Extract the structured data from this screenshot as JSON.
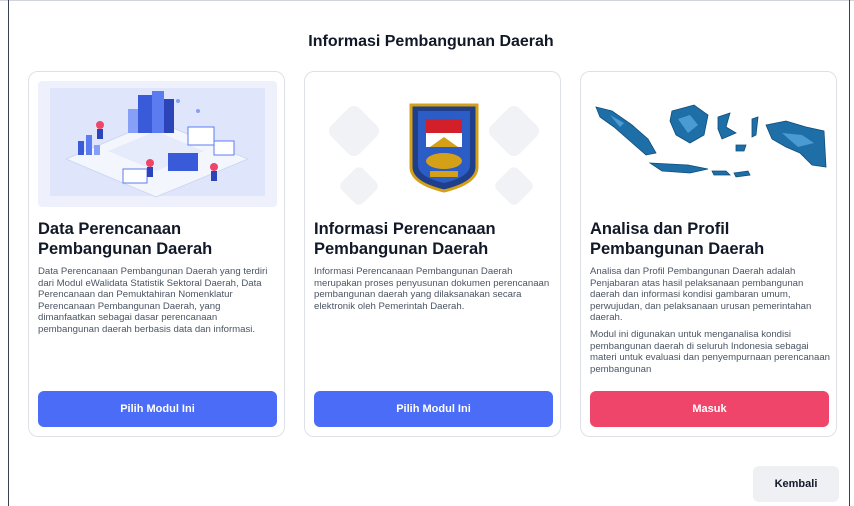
{
  "page": {
    "title": "Informasi Pembangunan Daerah"
  },
  "cards": [
    {
      "title": "Data Perencanaan Pembangunan Daerah",
      "description": [
        "Data Perencanaan Pembangunan Daerah yang terdiri dari Modul eWalidata Statistik Sektoral Daerah, Data Perencanaan dan Pemuktahiran Nomenklatur Perencanaan Pembangunan Daerah, yang dimanfaatkan sebagai dasar perencanaan pembangunan daerah berbasis data dan informasi."
      ],
      "button_label": "Pilih Modul Ini",
      "button_color": "#4a6cf7",
      "image_icon": "isometric-data-illustration"
    },
    {
      "title": "Informasi Perencanaan Pembangunan Daerah",
      "description": [
        "Informasi Perencanaan Pembangunan Daerah merupakan proses penyusunan dokumen perencanaan pembangunan daerah yang dilaksanakan secara elektronik oleh Pemerintah Daerah."
      ],
      "button_label": "Pilih Modul Ini",
      "button_color": "#4a6cf7",
      "image_icon": "ministry-emblem"
    },
    {
      "title": "Analisa dan Profil Pembangunan Daerah",
      "description": [
        "Analisa dan Profil Pembangunan Daerah adalah Penjabaran atas hasil pelaksanaan pembangunan daerah dan informasi kondisi gambaran umum, perwujudan, dan pelaksanaan urusan pemerintahan daerah.",
        "Modul ini digunakan untuk menganalisa kondisi pembangunan daerah di seluruh Indonesia sebagai materi untuk evaluasi dan penyempurnaan perencanaan pembangunan"
      ],
      "button_label": "Masuk",
      "button_color": "#f0456a",
      "image_icon": "indonesia-map"
    }
  ],
  "back_button": {
    "label": "Kembali"
  }
}
